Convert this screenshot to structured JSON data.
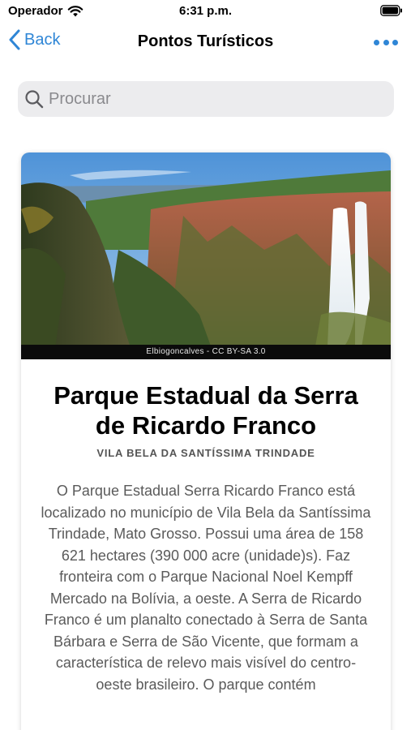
{
  "status_bar": {
    "carrier": "Operador",
    "time": "6:31 p.m."
  },
  "nav": {
    "back_label": "Back",
    "title": "Pontos Turísticos"
  },
  "search": {
    "placeholder": "Procurar"
  },
  "card": {
    "image_credit": "Elbiogoncalves - CC BY-SA 3.0",
    "title": "Parque Estadual da Serra de Ricardo Franco",
    "subtitle": "VILA BELA DA SANTÍSSIMA TRINDADE",
    "description": "O Parque Estadual Serra Ricardo Franco está localizado no município de Vila Bela da Santíssima Trindade, Mato Grosso. Possui uma área de 158 621 hectares (390 000 acre (unidade)s). Faz fronteira com o Parque Nacional Noel Kempff Mercado na Bolívia, a oeste. A Serra de Ricardo Franco é um planalto conectado à Serra de Santa Bárbara e Serra de São Vicente, que formam a característica de relevo mais visível do centro-oeste brasileiro. O parque contém"
  },
  "colors": {
    "accent": "#2f86d6",
    "search_bg": "#ececee",
    "secondary_text": "#5a5a5a"
  },
  "icons": {
    "wifi": "wifi-icon",
    "battery": "battery-icon",
    "back": "chevron-left-icon",
    "more": "ellipsis-icon",
    "search": "search-icon"
  }
}
